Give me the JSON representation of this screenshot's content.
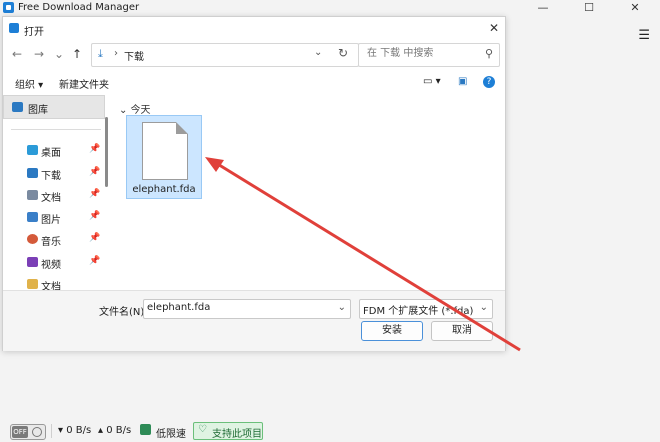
{
  "app": {
    "title": "Free Download Manager",
    "minimize": "—",
    "maximize": "☐",
    "close": "✕",
    "menu_icon": "menu-icon"
  },
  "dialog": {
    "title": "打开",
    "close": "✕",
    "nav": {
      "back": "←",
      "forward": "→",
      "recent": "⌄",
      "up": "↑"
    },
    "address": {
      "path": "下载",
      "separator": "›",
      "chevron": "⌄",
      "refresh": "↻"
    },
    "search": {
      "placeholder": "在 下载 中搜索",
      "icon": "⚲"
    },
    "toolbar": {
      "organize": "组织 ▾",
      "new_folder": "新建文件夹",
      "view": "▭ ▾",
      "pane": "▣",
      "help": "?"
    },
    "left_pane": {
      "items": [
        {
          "label": "图库",
          "selected": true,
          "pinned": false,
          "color": "#2b79c2"
        },
        {
          "label": "桌面",
          "selected": false,
          "pinned": true,
          "color": "#2b9bd8"
        },
        {
          "label": "下载",
          "selected": false,
          "pinned": true,
          "color": "#2b79c2"
        },
        {
          "label": "文档",
          "selected": false,
          "pinned": true,
          "color": "#7a8aa0"
        },
        {
          "label": "图片",
          "selected": false,
          "pinned": true,
          "color": "#3a7fc8"
        },
        {
          "label": "音乐",
          "selected": false,
          "pinned": true,
          "color": "#d45a3a"
        },
        {
          "label": "视频",
          "selected": false,
          "pinned": true,
          "color": "#7b3fb6"
        },
        {
          "label": "文档",
          "selected": false,
          "pinned": false,
          "color": "#e0b24a"
        }
      ],
      "pin_icon": "📌"
    },
    "content": {
      "group_header": "⌄ 今天",
      "file": {
        "name": "elephant.fda"
      }
    },
    "bottom": {
      "filename_label": "文件名(N):",
      "filename_value": "elephant.fda",
      "filetype_value": "FDM 个扩展文件 (*.fda)",
      "dropdown": "⌄",
      "install": "安装",
      "cancel": "取消"
    }
  },
  "statusbar": {
    "off_label": "OFF",
    "down_speed": "▾ 0 B/s",
    "up_speed": "▴ 0 B/s",
    "low_speed": "低限速",
    "support": "支持此项目",
    "support_icon": "♡"
  },
  "colors": {
    "accent": "#1e7fd6",
    "arrow": "#e0403a",
    "selection": "#cce6ff",
    "support_green": "#2e8b57"
  }
}
